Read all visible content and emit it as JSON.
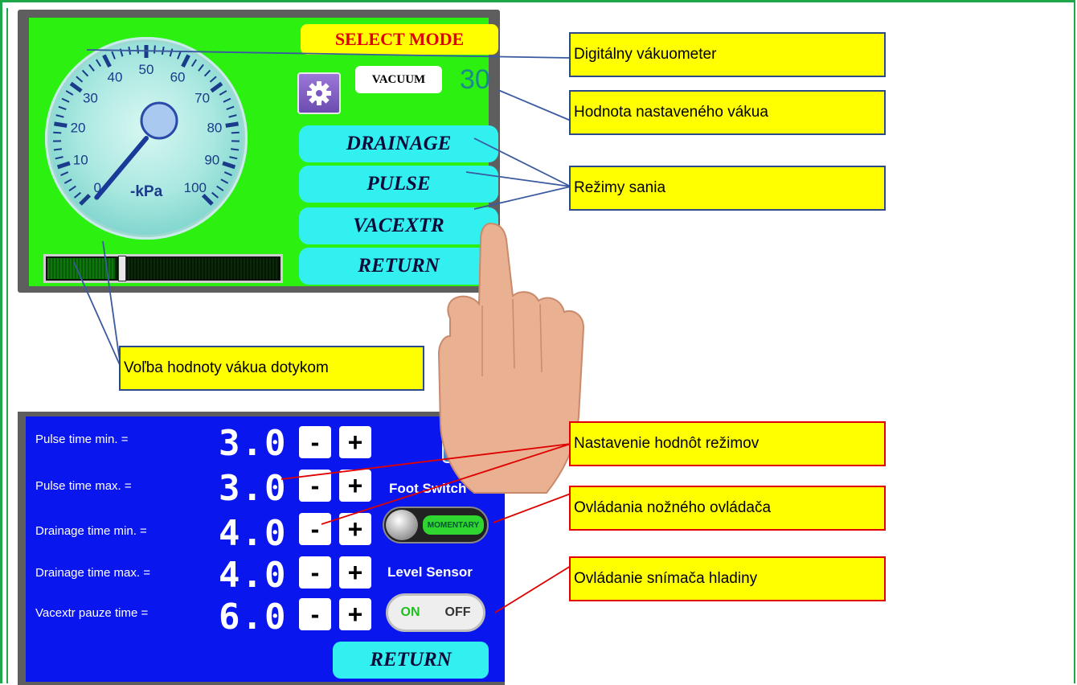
{
  "top_screen": {
    "select_mode": "SELECT MODE",
    "vacuum_label": "VACUUM",
    "vacuum_value": "30",
    "gauge": {
      "unit": "-kPa",
      "ticks": [
        "0",
        "10",
        "20",
        "30",
        "40",
        "50",
        "60",
        "70",
        "80",
        "90",
        "100"
      ]
    },
    "modes": [
      "DRAINAGE",
      "PULSE",
      "VACEXTR",
      "RETURN"
    ],
    "slider_level_percent": 30
  },
  "bottom_screen": {
    "rows": [
      {
        "label": "Pulse time min. =",
        "value": "3.0",
        "minus": "-",
        "plus": "+"
      },
      {
        "label": "Pulse time max. =",
        "value": "3.0",
        "minus": "-",
        "plus": "+"
      },
      {
        "label": "Drainage time min. =",
        "value": "4.0",
        "minus": "-",
        "plus": "+"
      },
      {
        "label": "Drainage time max. =",
        "value": "4.0",
        "minus": "-",
        "plus": "+"
      },
      {
        "label": "Vacextr pauze time =",
        "value": "6.0",
        "minus": "-",
        "plus": "+"
      }
    ],
    "foot_switch_title": "Foot Switch",
    "foot_switch_state": "MOMENTARY",
    "level_sensor_title": "Level Sensor",
    "level_on": "ON",
    "level_off": "OFF",
    "return_label": "RETURN"
  },
  "callouts": {
    "digital_vacuometer": "Digitálny vákuometer",
    "set_vacuum_value": "Hodnota nastaveného vákua",
    "suction_modes": "Režimy sania",
    "touch_vacuum": "Voľba hodnoty vákua dotykom",
    "mode_values": "Nastavenie hodnôt režimov",
    "foot_control": "Ovládania nožného ovládača",
    "level_sensor_control": "Ovládanie snímača hladiny"
  },
  "colors": {
    "top_bg": "#2cf00f",
    "bottom_bg": "#0a16ee",
    "button_cyan": "#33f0f0",
    "callout_yellow": "#ffff00"
  }
}
